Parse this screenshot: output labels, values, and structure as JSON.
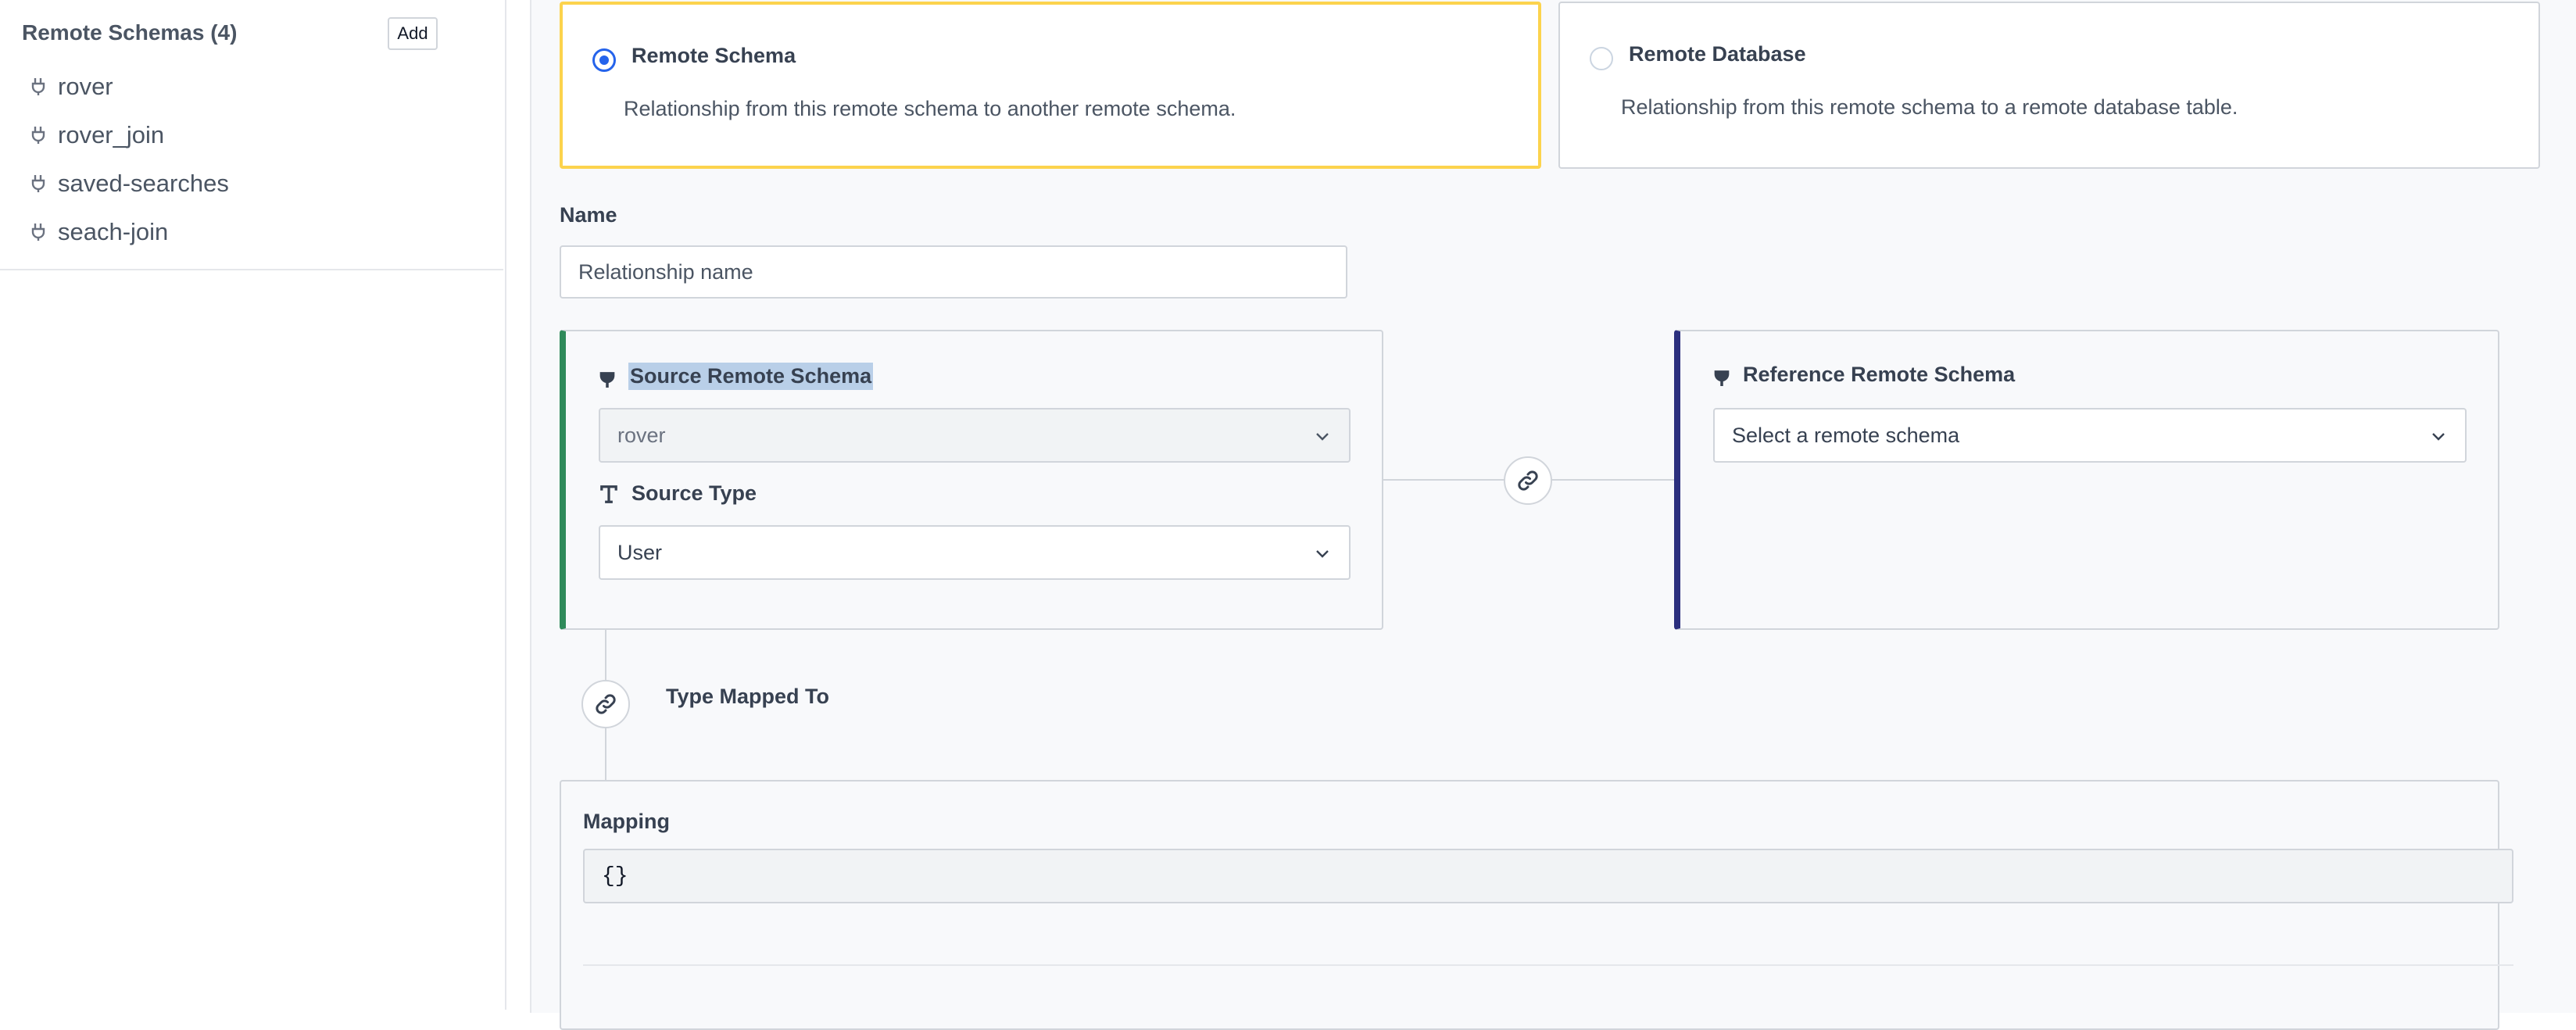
{
  "sidebar": {
    "heading": "Remote Schemas (4)",
    "add_label": "Add",
    "items": [
      {
        "label": "rover",
        "icon": "plug-icon"
      },
      {
        "label": "rover_join",
        "icon": "plug-icon"
      },
      {
        "label": "saved-searches",
        "icon": "plug-icon"
      },
      {
        "label": "seach-join",
        "icon": "plug-icon"
      }
    ]
  },
  "relationship_type": {
    "selected": "Remote Schema",
    "options": [
      {
        "title": "Remote Schema",
        "description": "Relationship from this remote schema to another remote schema."
      },
      {
        "title": "Remote Database",
        "description": "Relationship from this remote schema to a remote database table."
      }
    ]
  },
  "name_field": {
    "label": "Name",
    "placeholder": "Relationship name",
    "value": ""
  },
  "source": {
    "heading": "Source Remote Schema",
    "schema_value": "rover",
    "type_heading": "Source Type",
    "type_value": "User"
  },
  "reference": {
    "heading": "Reference Remote Schema",
    "placeholder": "Select a remote schema"
  },
  "type_mapped_label": "Type Mapped To",
  "mapping": {
    "label": "Mapping",
    "value": "{}"
  },
  "colors": {
    "selected_card_border": "#fcd34d",
    "radio_selected": "#2563eb",
    "source_accent": "#2f8a5a",
    "reference_accent": "#2b2f7e",
    "text_highlight": "#b9cfe8"
  }
}
